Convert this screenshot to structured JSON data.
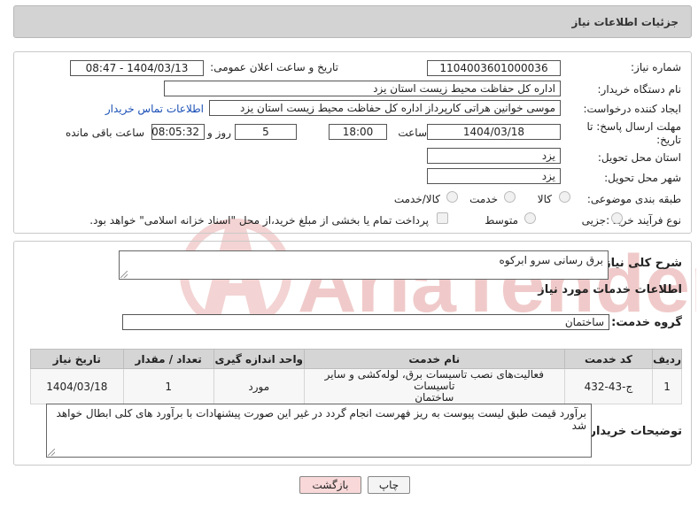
{
  "header": {
    "title": "جزئیات اطلاعات نیاز"
  },
  "form": {
    "need_number_label": "شماره نیاز:",
    "need_number": "1104003601000036",
    "announce_label": "تاریخ و ساعت اعلان عمومی:",
    "announce_value": "1404/03/13 - 08:47",
    "buyer_label": "نام دستگاه خریدار:",
    "buyer_value": "اداره کل حفاظت محیط زیست استان یزد",
    "creator_label": "ایجاد کننده درخواست:",
    "creator_value": "موسی خوانین هراتی کارپرداز اداره کل حفاظت محیط زیست استان یزد",
    "contact_link": "اطلاعات تماس خریدار",
    "deadline_label_1": "مهلت ارسال پاسخ: تا",
    "deadline_label_2": "تاریخ:",
    "deadline_date": "1404/03/18",
    "time_label": "ساعت",
    "deadline_time": "18:00",
    "days_value": "5",
    "days_label": "روز و",
    "remaining_value": "08:05:32",
    "remaining_label": "ساعت باقی مانده",
    "province_label": "استان محل تحویل:",
    "province_value": "یزد",
    "city_label": "شهر محل تحویل:",
    "city_value": "یزد",
    "category_label": "طبقه بندی موضوعی:",
    "category_options": [
      "کالا",
      "خدمت",
      "کالا/خدمت"
    ],
    "process_label": "نوع فرآیند خرید :",
    "process_options": [
      "جزیی",
      "متوسط"
    ],
    "payment_note": "پرداخت تمام یا بخشی از مبلغ خرید،از محل \"اسناد خزانه اسلامی\" خواهد بود."
  },
  "summary": {
    "label": "شرح کلی نیاز:",
    "value": "برق رسانی سرو ابرکوه"
  },
  "services": {
    "title": "اطلاعات خدمات مورد نیاز",
    "group_label": "گروه خدمت:",
    "group_value": "ساختمان",
    "columns": [
      "ردیف",
      "کد خدمت",
      "نام خدمت",
      "واحد اندازه گیری",
      "تعداد / مقدار",
      "تاریخ نیاز"
    ],
    "rows": [
      {
        "index": "1",
        "code": "ج-43-432",
        "name_1": "فعالیت‌های نصب تاسیسات برق، لوله‌کشی و سایر تاسیسات",
        "name_2": "ساختمان",
        "unit": "مورد",
        "qty": "1",
        "date": "1404/03/18"
      }
    ]
  },
  "buyer_notes": {
    "label": "توضیحات خریدار:",
    "value": "برآورد قیمت طبق لیست پیوست به ریز فهرست انجام گردد در غیر این صورت پیشنهادات با برآورد های کلی ابطال خواهد شد"
  },
  "buttons": {
    "print": "چاپ",
    "back": "بازگشت"
  },
  "watermark": {
    "text": "AriaTender.neT"
  },
  "colors": {
    "link": "#1a4fb5",
    "back_button": "#f8d8d8",
    "print_button": "#f4f4f4",
    "watermark": "#f0caca"
  }
}
